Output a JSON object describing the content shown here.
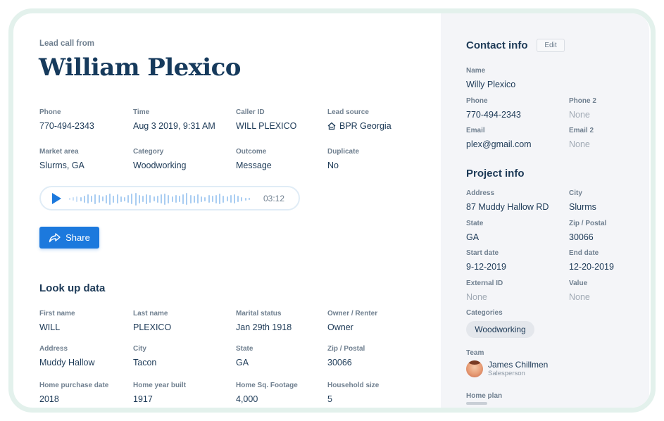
{
  "lead": {
    "eyebrow": "Lead call from",
    "name": "William Plexico",
    "fields": {
      "phone": {
        "label": "Phone",
        "value": "770-494-2343"
      },
      "time": {
        "label": "Time",
        "value": "Aug 3 2019, 9:31 AM"
      },
      "caller_id": {
        "label": "Caller ID",
        "value": "WILL PLEXICO"
      },
      "lead_source": {
        "label": "Lead source",
        "value": "BPR Georgia"
      },
      "market_area": {
        "label": "Market area",
        "value": "Slurms, GA"
      },
      "category": {
        "label": "Category",
        "value": "Woodworking"
      },
      "outcome": {
        "label": "Outcome",
        "value": "Message"
      },
      "duplicate": {
        "label": "Duplicate",
        "value": "No"
      }
    },
    "player": {
      "duration": "03:12",
      "icon": "play-icon"
    },
    "share_label": "Share"
  },
  "lookup": {
    "title": "Look up data",
    "fields": {
      "first_name": {
        "label": "First name",
        "value": "WILL"
      },
      "last_name": {
        "label": "Last name",
        "value": "PLEXICO"
      },
      "marital_status": {
        "label": "Marital status",
        "value": "Jan 29th 1918"
      },
      "owner_renter": {
        "label": "Owner / Renter",
        "value": "Owner"
      },
      "address": {
        "label": "Address",
        "value": "Muddy Hallow"
      },
      "city": {
        "label": "City",
        "value": "Tacon"
      },
      "state": {
        "label": "State",
        "value": "GA"
      },
      "zip": {
        "label": "Zip / Postal",
        "value": "30066"
      },
      "home_purchase_date": {
        "label": "Home purchase date",
        "value": "2018"
      },
      "home_year_built": {
        "label": "Home year built",
        "value": "1917"
      },
      "home_sq_footage": {
        "label": "Home Sq. Footage",
        "value": "4,000"
      },
      "household_size": {
        "label": "Household size",
        "value": "5"
      }
    }
  },
  "contact": {
    "title": "Contact info",
    "edit_label": "Edit",
    "fields": {
      "name": {
        "label": "Name",
        "value": "Willy Plexico"
      },
      "phone": {
        "label": "Phone",
        "value": "770-494-2343"
      },
      "phone2": {
        "label": "Phone 2",
        "value": "None"
      },
      "email": {
        "label": "Email",
        "value": "plex@gmail.com"
      },
      "email2": {
        "label": "Email 2",
        "value": "None"
      }
    }
  },
  "project": {
    "title": "Project info",
    "fields": {
      "address": {
        "label": "Address",
        "value": "87 Muddy Hallow RD"
      },
      "city": {
        "label": "City",
        "value": "Slurms"
      },
      "state": {
        "label": "State",
        "value": "GA"
      },
      "zip": {
        "label": "Zip / Postal",
        "value": "30066"
      },
      "start_date": {
        "label": "Start date",
        "value": "9-12-2019"
      },
      "end_date": {
        "label": "End date",
        "value": "12-20-2019"
      },
      "external_id": {
        "label": "External ID",
        "value": "None"
      },
      "value": {
        "label": "Value",
        "value": "None"
      }
    },
    "categories_label": "Categories",
    "categories": [
      "Woodworking"
    ],
    "team_label": "Team",
    "team": [
      {
        "name": "James Chillmen",
        "role": "Salesperson"
      }
    ],
    "home_plan_label": "Home plan"
  },
  "colors": {
    "accent": "#1c79dd",
    "heading": "#163a5c",
    "frame": "#e3f1ec",
    "panel": "#f4f5f8"
  }
}
